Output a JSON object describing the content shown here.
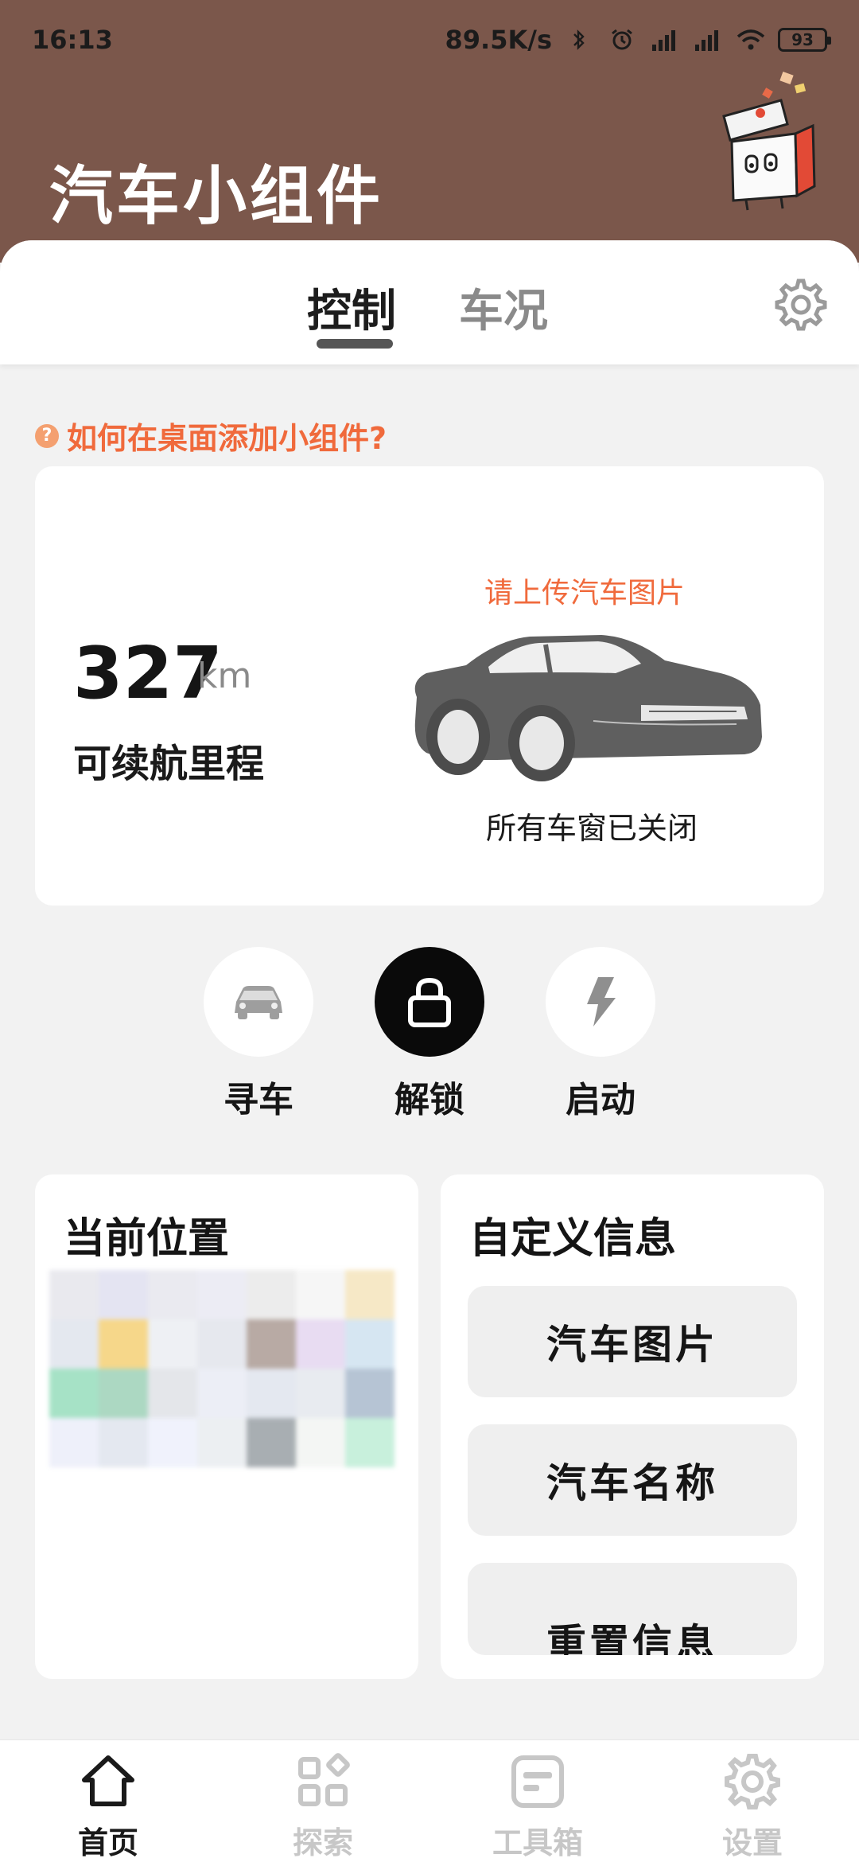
{
  "status_bar": {
    "time": "16:13",
    "net_speed": "89.5K/s",
    "battery": "93"
  },
  "header": {
    "title": "汽车小组件"
  },
  "tabs": [
    {
      "label": "控制",
      "active": true
    },
    {
      "label": "车况",
      "active": false
    }
  ],
  "help_link": {
    "icon": "?",
    "text": "如何在桌面添加小组件?"
  },
  "car_card": {
    "range_value": "327",
    "range_unit": "km",
    "range_label": "可续航里程",
    "upload_hint": "请上传汽车图片",
    "window_status": "所有车窗已关闭"
  },
  "actions": [
    {
      "label": "寻车",
      "icon": "car-icon"
    },
    {
      "label": "解锁",
      "icon": "lock-icon"
    },
    {
      "label": "启动",
      "icon": "lightning-icon"
    }
  ],
  "location_card": {
    "title": "当前位置"
  },
  "custom_info_card": {
    "title": "自定义信息",
    "buttons": [
      "汽车图片",
      "汽车名称",
      "重置信息"
    ]
  },
  "bottom_nav": [
    {
      "label": "首页",
      "icon": "home-icon",
      "active": true
    },
    {
      "label": "探索",
      "icon": "grid-icon",
      "active": false
    },
    {
      "label": "工具箱",
      "icon": "toolbox-icon",
      "active": false
    },
    {
      "label": "设置",
      "icon": "gear-icon",
      "active": false
    }
  ],
  "colors": {
    "header_bg": "#7b574b",
    "accent": "#f06a3c",
    "page_bg": "#f2f2f2"
  }
}
